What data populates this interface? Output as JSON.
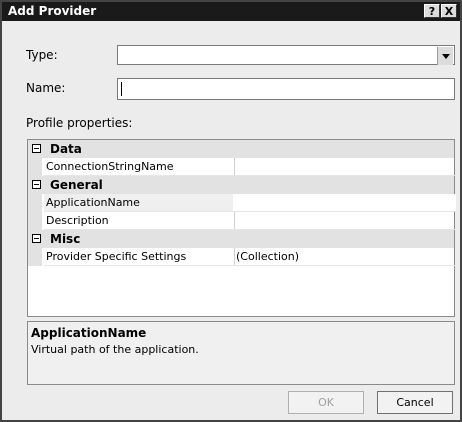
{
  "window": {
    "title": "Add Provider",
    "help_glyph": "?",
    "close_glyph": "X"
  },
  "form": {
    "type_label": "Type:",
    "type_value": "",
    "name_label": "Name:",
    "name_value": "",
    "profile_label": "Profile properties:"
  },
  "grid": {
    "categories": [
      {
        "label": "Data",
        "properties": [
          {
            "name": "ConnectionStringName",
            "value": ""
          }
        ]
      },
      {
        "label": "General",
        "properties": [
          {
            "name": "ApplicationName",
            "value": ""
          },
          {
            "name": "Description",
            "value": ""
          }
        ]
      },
      {
        "label": "Misc",
        "properties": [
          {
            "name": "Provider Specific Settings",
            "value": "(Collection)"
          }
        ]
      }
    ],
    "selected_property": "ApplicationName"
  },
  "description": {
    "title": "ApplicationName",
    "text": "Virtual path of the application."
  },
  "buttons": {
    "ok_label": "OK",
    "ok_enabled": false,
    "cancel_label": "Cancel"
  }
}
